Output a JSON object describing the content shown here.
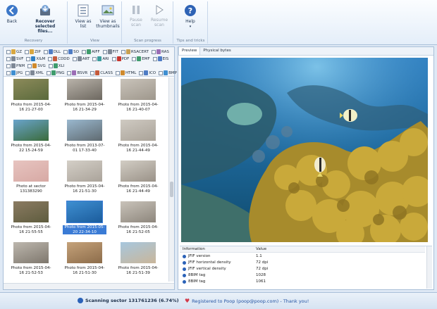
{
  "ribbon": {
    "groups": [
      {
        "label": "Recovery"
      },
      {
        "label": "View"
      },
      {
        "label": "Scan progress"
      },
      {
        "label": "Tips and tricks"
      }
    ],
    "buttons": {
      "back": "Back",
      "recover_line1": "Recover selected",
      "recover_line2": "files...",
      "view_list_line1": "View as",
      "view_list_line2": "list",
      "view_thumbs_line1": "View as",
      "view_thumbs_line2": "thumbnails",
      "pause_line1": "Pause",
      "pause_line2": "scan",
      "resume_line1": "Resume",
      "resume_line2": "scan",
      "help": "Help"
    }
  },
  "filters": {
    "row1": [
      "GZ",
      "ZIP",
      "DLL",
      "SO",
      "AIFF",
      "FIT",
      "RSACERT",
      "RAS"
    ],
    "row2": [
      "SVF",
      "X&M",
      "CDDD",
      "ART",
      "ARI",
      "PDF",
      "EMF",
      "EIS"
    ],
    "row3": [
      "PNM",
      "SVG",
      "XLI",
      "",
      "",
      "",
      "",
      ""
    ],
    "row4": [
      "JPG",
      "XML",
      "PNG",
      "BSVR",
      "CLASS",
      "HTML",
      "ICO",
      "BMP"
    ],
    "colors": {
      "GZ": "#d9a740",
      "ZIP": "#d9a740",
      "DLL": "#4f7cc4",
      "SO": "#4f7cc4",
      "AIFF": "#3f9c6d",
      "FIT": "#7d8795",
      "RSACERT": "#c7a052",
      "RAS": "#9b6db5",
      "SVF": "#7d8795",
      "X&M": "#2f7fc4",
      "CDDD": "#c45a3b",
      "ART": "#7d8795",
      "ARI": "#3a9c9c",
      "PDF": "#c8352d",
      "EMF": "#3f9c6d",
      "EIS": "#4f7cc4",
      "PNM": "#7d8795",
      "SVG": "#d08a2c",
      "XLI": "#3f9c6d",
      "JPG": "#3f8fd1",
      "XML": "#7d8795",
      "PNG": "#3f9c6d",
      "BSVR": "#9b6db5",
      "CLASS": "#c45a3b",
      "HTML": "#d08a2c",
      "ICO": "#4f7cc4",
      "BMP": "#3f8fd1"
    }
  },
  "thumbnails": [
    {
      "caption": "Photo from 2015-04-16 21-27-00",
      "colors": [
        "#8c8a5a",
        "#5a6a3c"
      ]
    },
    {
      "caption": "Photo from 2015-04-16 21-34-29",
      "colors": [
        "#b9b3aa",
        "#6d6860"
      ]
    },
    {
      "caption": "Photo from 2015-04-16 21-40-07",
      "colors": [
        "#c9c3ba",
        "#9e978c"
      ]
    },
    {
      "caption": "Photo from 2015-04-22 15-24-59",
      "colors": [
        "#6aa4cc",
        "#3a6b3a"
      ]
    },
    {
      "caption": "Photo from 2013-07-01 17-33-40",
      "colors": [
        "#9ab8cf",
        "#5f6a70"
      ]
    },
    {
      "caption": "Photo from 2015-04-16 21-44-49",
      "colors": [
        "#cfcac2",
        "#a9a298"
      ]
    },
    {
      "caption": "Photo at sector 131383290",
      "colors": [
        "#e7c4c0",
        "#d7a9a4"
      ]
    },
    {
      "caption": "Photo from 2015-04-16 21-51-30",
      "colors": [
        "#d4cfc7",
        "#aaa39a"
      ]
    },
    {
      "caption": "Photo from 2015-04-16 21-44-49",
      "colors": [
        "#d2cdc4",
        "#9a9288"
      ]
    },
    {
      "caption": "Photo from 2015-04-16 21-55-55",
      "colors": [
        "#8b7b62",
        "#5e5c3e"
      ]
    },
    {
      "caption": "Photo from 2015-05-20 22-34-10",
      "colors": [
        "#3f8fd1",
        "#1b5c9c"
      ]
    },
    {
      "caption": "Photo from 2015-04-16 21-52-05",
      "colors": [
        "#c9c3ba",
        "#8d867c"
      ]
    },
    {
      "caption": "Photo from 2015-04-16 21-52-53",
      "colors": [
        "#bdb7ae",
        "#7e776d"
      ]
    },
    {
      "caption": "Photo from 2015-04-16 21-51-30",
      "colors": [
        "#c5a27a",
        "#8c6c4a"
      ]
    },
    {
      "caption": "Photo from 2015-04-16 21-51-39",
      "colors": [
        "#a7c7de",
        "#c9b69a"
      ]
    }
  ],
  "selected_thumbnail": 10,
  "preview": {
    "tabs": [
      "Preview",
      "Physical bytes"
    ],
    "active_tab": 0
  },
  "info": {
    "col_information": "Information",
    "col_value": "Value",
    "rows": [
      {
        "key": "JFIF version",
        "value": "1.1"
      },
      {
        "key": "JFIF horizontal density",
        "value": "72 dpi"
      },
      {
        "key": "JFIF vertical density",
        "value": "72 dpi"
      },
      {
        "key": "8BIM tag",
        "value": "1028"
      },
      {
        "key": "8BIM tag",
        "value": "1061"
      }
    ]
  },
  "status": {
    "scanning": "Scanning sector 131761236 (6.74%)",
    "registered": "Registered to Poop (poop@poop.com) - Thank you!",
    "accent": "#2b62b8"
  }
}
